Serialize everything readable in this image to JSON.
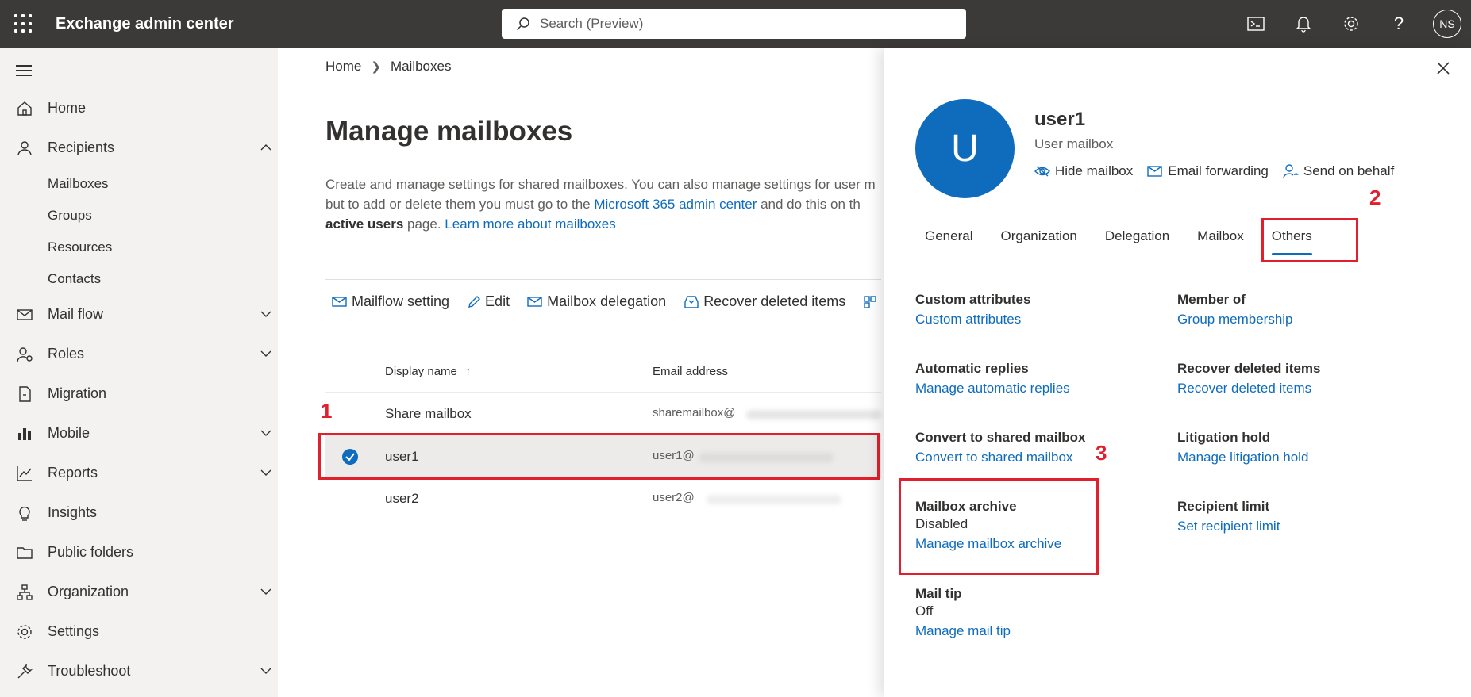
{
  "app": {
    "title": "Exchange admin center",
    "user_initials": "NS"
  },
  "search": {
    "placeholder": "Search (Preview)"
  },
  "sidebar": {
    "items": [
      {
        "label": "Home"
      },
      {
        "label": "Recipients"
      },
      {
        "label": "Mail flow"
      },
      {
        "label": "Roles"
      },
      {
        "label": "Migration"
      },
      {
        "label": "Mobile"
      },
      {
        "label": "Reports"
      },
      {
        "label": "Insights"
      },
      {
        "label": "Public folders"
      },
      {
        "label": "Organization"
      },
      {
        "label": "Settings"
      },
      {
        "label": "Troubleshoot"
      }
    ],
    "recipients_sub": [
      "Mailboxes",
      "Groups",
      "Resources",
      "Contacts"
    ]
  },
  "breadcrumb": {
    "home": "Home",
    "current": "Mailboxes"
  },
  "main": {
    "title": "Manage mailboxes",
    "desc_1": "Create and manage settings for shared mailboxes. You can also manage settings for user m",
    "desc_2a": "but to add or delete them you must go to the ",
    "desc_2_link": "Microsoft 365 admin center",
    "desc_2b": " and do this on th",
    "desc_3_bold": "active users",
    "desc_3a": " page. ",
    "desc_3_link": "Learn more about mailboxes"
  },
  "toolbar": {
    "mailflow": "Mailflow setting",
    "edit": "Edit",
    "delegation": "Mailbox delegation",
    "recover": "Recover deleted items"
  },
  "table": {
    "col_display_name": "Display name",
    "col_email": "Email address",
    "rows": [
      {
        "name": "Share mailbox",
        "email": "sharemailbox@"
      },
      {
        "name": "user1",
        "email": "user1@"
      },
      {
        "name": "user2",
        "email": "user2@"
      }
    ]
  },
  "annotations": {
    "n1": "1",
    "n2": "2",
    "n3": "3",
    "color": "#e0202c"
  },
  "panel": {
    "avatar_letter": "U",
    "name": "user1",
    "type": "User mailbox",
    "actions": {
      "hide": "Hide mailbox",
      "forward": "Email forwarding",
      "behalf": "Send on behalf"
    },
    "tabs": [
      "General",
      "Organization",
      "Delegation",
      "Mailbox",
      "Others"
    ],
    "sections": {
      "custom": {
        "title": "Custom attributes",
        "link": "Custom attributes"
      },
      "member": {
        "title": "Member of",
        "link": "Group membership"
      },
      "auto": {
        "title": "Automatic replies",
        "link": "Manage automatic replies"
      },
      "recover": {
        "title": "Recover deleted items",
        "link": "Recover deleted items"
      },
      "convert": {
        "title": "Convert to shared mailbox",
        "link": "Convert to shared mailbox"
      },
      "litigation": {
        "title": "Litigation hold",
        "link": "Manage litigation hold"
      },
      "archive": {
        "title": "Mailbox archive",
        "value": "Disabled",
        "link": "Manage mailbox archive"
      },
      "limit": {
        "title": "Recipient limit",
        "link": "Set recipient limit"
      },
      "tip": {
        "title": "Mail tip",
        "value": "Off",
        "link": "Manage mail tip"
      }
    }
  },
  "colors": {
    "accent": "#0f6cbd",
    "topbar": "#3b3a39",
    "sidebar": "#f3f2f1"
  }
}
